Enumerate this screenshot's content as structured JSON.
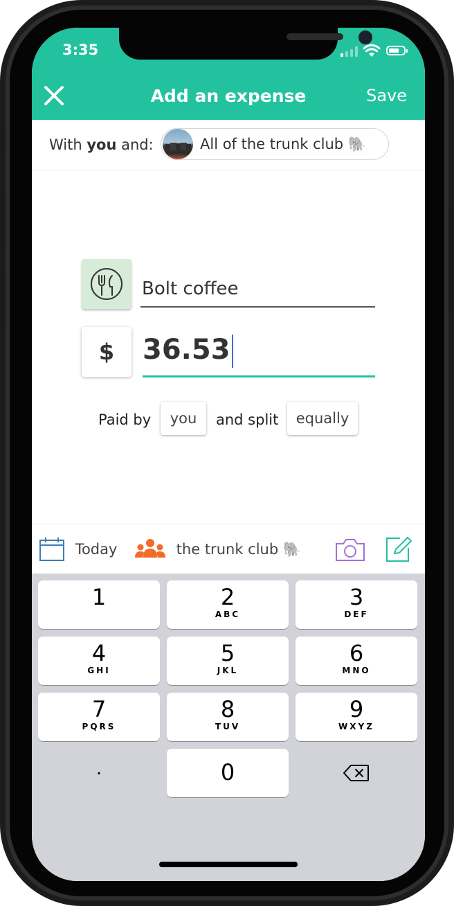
{
  "status_bar": {
    "time": "3:35"
  },
  "header": {
    "title": "Add an expense",
    "save_label": "Save"
  },
  "with_row": {
    "prefix": "With ",
    "you": "you",
    "suffix": " and:",
    "group_name": "All of the trunk club 🐘"
  },
  "expense": {
    "description": "Bolt coffee",
    "currency_symbol": "$",
    "amount": "36.53"
  },
  "split": {
    "paid_by_label": "Paid by",
    "payer": "you",
    "and_split_label": "and split",
    "split_method": "equally"
  },
  "toolbar": {
    "date_label": "Today",
    "group_label": "the trunk club 🐘"
  },
  "keypad": {
    "keys": [
      {
        "num": "1",
        "letters": ""
      },
      {
        "num": "2",
        "letters": "ABC"
      },
      {
        "num": "3",
        "letters": "DEF"
      },
      {
        "num": "4",
        "letters": "GHI"
      },
      {
        "num": "5",
        "letters": "JKL"
      },
      {
        "num": "6",
        "letters": "MNO"
      },
      {
        "num": "7",
        "letters": "PQRS"
      },
      {
        "num": "8",
        "letters": "TUV"
      },
      {
        "num": "9",
        "letters": "WXYZ"
      }
    ],
    "decimal": ".",
    "zero": "0"
  },
  "colors": {
    "brand": "#22c29e",
    "category_bg": "#d7ebd9",
    "group_icon": "#f26b2a",
    "camera_icon": "#a66fd6",
    "note_icon": "#22c29e",
    "date_icon": "#3d7db5"
  }
}
